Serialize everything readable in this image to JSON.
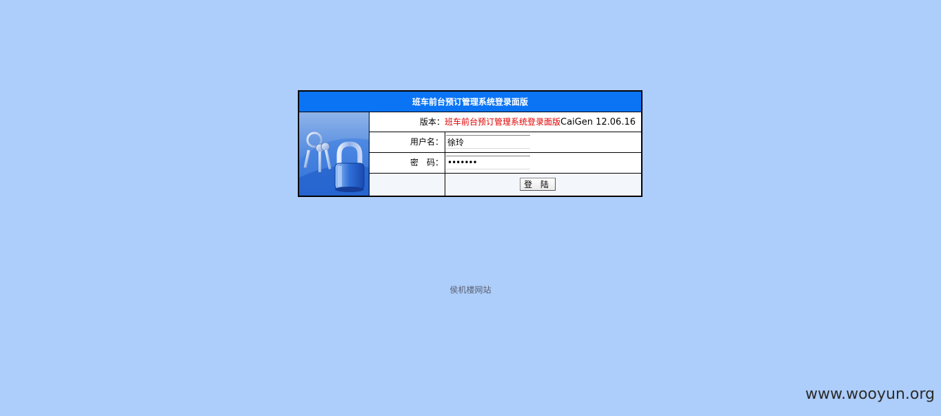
{
  "header": {
    "title": "班车前台预订管理系统登录面版"
  },
  "version": {
    "label": "版本：",
    "name": "班车前台预订管理系统登录面版",
    "code": "CaiGen 12.06.16"
  },
  "form": {
    "username_label": "用户名：",
    "username_value": "徐玲",
    "password_label": "密　码：",
    "password_value": "1234567",
    "login_button_label": "登 陆"
  },
  "footer": {
    "site_name": "侯机楼网站"
  },
  "watermark": {
    "text": "www.wooyun.org"
  },
  "colors": {
    "background": "#adcdfa",
    "header": "#0a74f5",
    "version_name": "#e00000"
  },
  "icons": {
    "lock_image": "keys-and-padlock-icon"
  }
}
